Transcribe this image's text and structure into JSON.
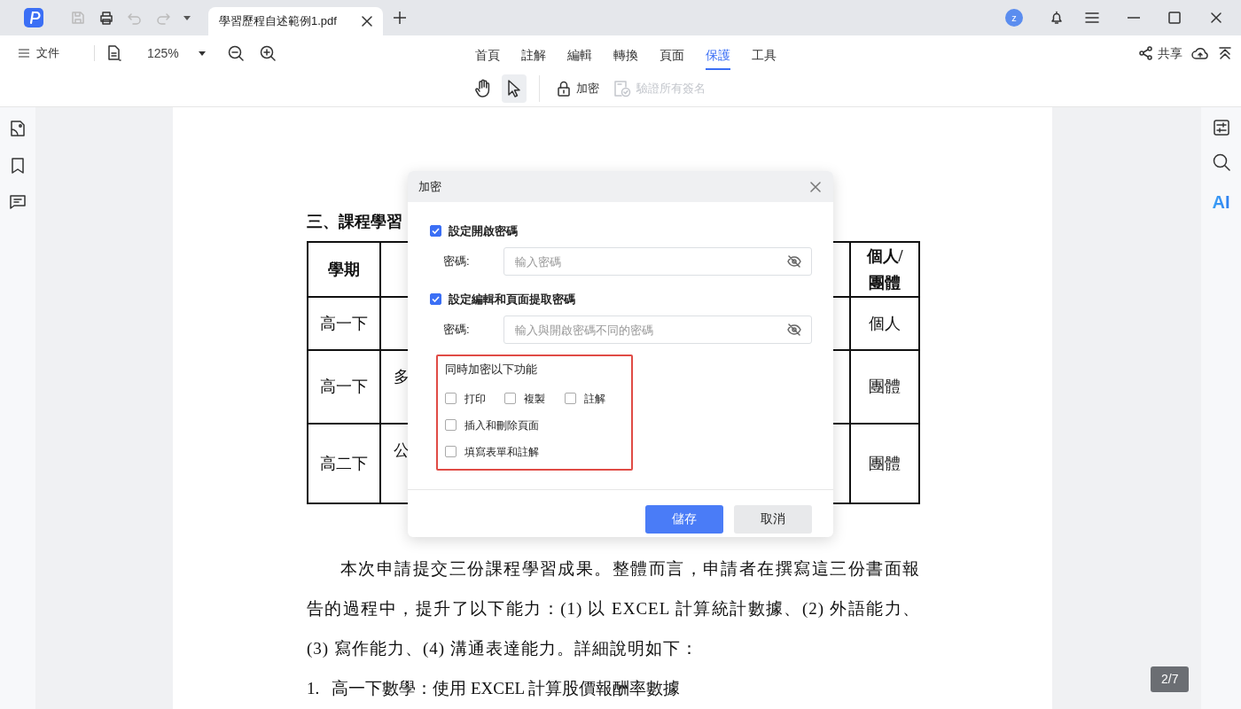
{
  "title_bar": {
    "tab": {
      "label": "學習歷程自述範例1.pdf"
    },
    "avatar": "z"
  },
  "toolbar": {
    "file_menu": "文件",
    "zoom": "125%",
    "tabs": [
      {
        "label": "首頁",
        "selected": false
      },
      {
        "label": "註解",
        "selected": false
      },
      {
        "label": "編輯",
        "selected": false
      },
      {
        "label": "轉換",
        "selected": false
      },
      {
        "label": "頁面",
        "selected": false
      },
      {
        "label": "保護",
        "selected": true
      },
      {
        "label": "工具",
        "selected": false
      }
    ],
    "share": "共享"
  },
  "tools": [
    {
      "kind": "hand",
      "selected": false,
      "disabled": false
    },
    {
      "kind": "pointer",
      "selected": true,
      "disabled": false
    },
    {
      "kind": "lock",
      "label": "加密",
      "selected": false,
      "disabled": false
    },
    {
      "kind": "verify",
      "label": "驗證所有簽名",
      "selected": false,
      "disabled": true
    }
  ],
  "right_rail": {
    "ai_label": "AI"
  },
  "document": {
    "heading": "三、課程學習",
    "table": {
      "header": {
        "column_1": "學期",
        "column_3": [
          "個人/",
          "團體"
        ]
      },
      "rows": [
        {
          "column_1": "高一下",
          "column_3": "個人"
        },
        {
          "column_1": "高一下",
          "column_2": "多",
          "column_3": "團體"
        },
        {
          "column_1": "高二下",
          "column_2": "公",
          "column_3": "團體"
        }
      ]
    },
    "paragraph": "本次申請提交三份課程學習成果。整體而言，申請者在撰寫這三份書面報告的過程中，提升了以下能力：(1) 以 EXCEL 計算統計數據、(2) 外語能力、(3) 寫作能力、(4) 溝通表達能力。詳細說明如下：",
    "list_item": {
      "number": "1.",
      "text": "高一下數學：使用 EXCEL 計算股價報酬率數據"
    }
  },
  "page_indicator": "2/7",
  "dialog": {
    "title": "加密",
    "sections": [
      {
        "label": "設定開啟密碼",
        "checked": true,
        "field_label": "密碼:",
        "placeholder": "輸入密碼"
      },
      {
        "label": "設定編輯和頁面提取密碼",
        "checked": true,
        "field_label": "密碼:",
        "placeholder": "輸入與開啟密碼不同的密碼"
      }
    ],
    "group": {
      "title": "同時加密以下功能",
      "option_rows": [
        [
          {
            "label": "打印",
            "checked": false
          },
          {
            "label": "複製",
            "checked": false
          },
          {
            "label": "註解",
            "checked": false
          }
        ],
        [
          {
            "label": "插入和刪除頁面",
            "checked": false
          }
        ],
        [
          {
            "label": "填寫表單和註解",
            "checked": false
          }
        ]
      ]
    },
    "buttons": [
      {
        "label": "儲存",
        "kind": "primary"
      },
      {
        "label": "取消",
        "kind": "secondary"
      }
    ]
  }
}
